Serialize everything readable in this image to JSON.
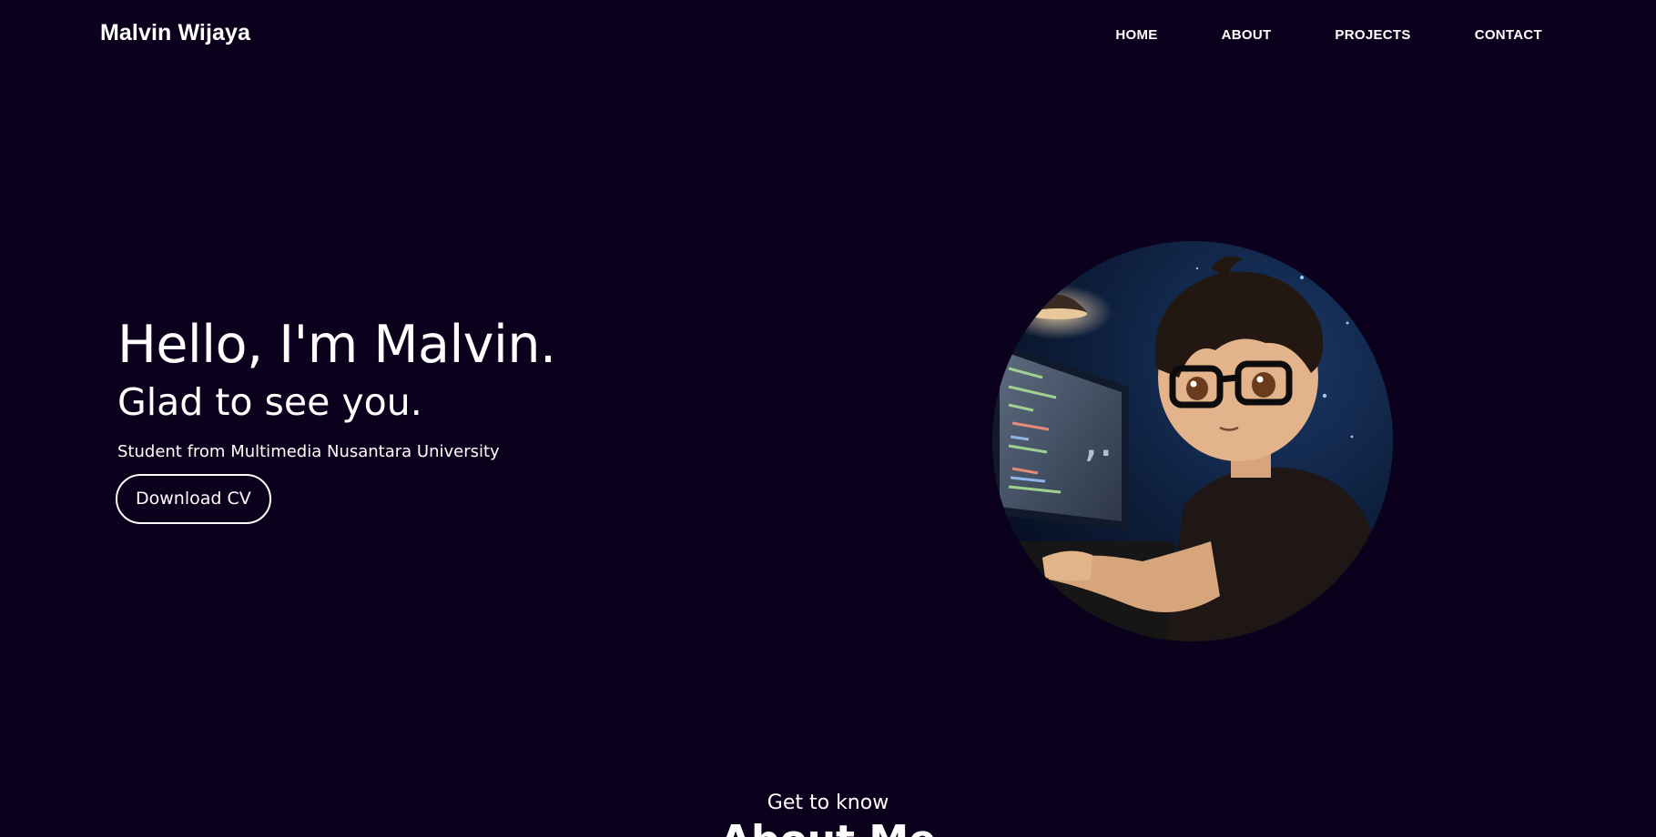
{
  "nav": {
    "brand": "Malvin Wijaya",
    "links": [
      "HOME",
      "ABOUT",
      "PROJECTS",
      "CONTACT"
    ]
  },
  "hero": {
    "greeting": "Hello, I'm Malvin.",
    "subtitle": "Glad to see you.",
    "description": "Student from Multimedia Nusantara University",
    "cv_button": "Download CV"
  },
  "about": {
    "pre_title": "Get to know",
    "title": "About Me"
  },
  "colors": {
    "background": "#0b011c",
    "text": "#ffffff"
  }
}
